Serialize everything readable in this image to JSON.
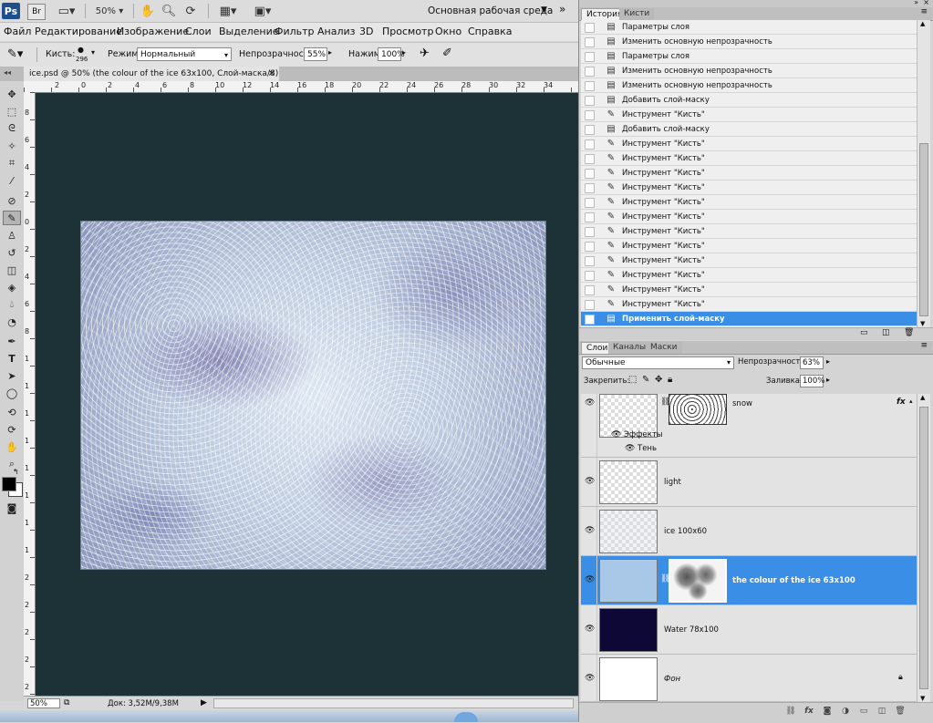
{
  "appbar": {
    "logo": "Ps",
    "bridge": "Br",
    "zoom": "50%",
    "workspace": "Основная рабочая среда"
  },
  "menu": [
    "Файл",
    "Редактирование",
    "Изображение",
    "Слои",
    "Выделение",
    "Фильтр",
    "Анализ",
    "3D",
    "Просмотр",
    "Окно",
    "Справка"
  ],
  "options": {
    "brush_label": "Кисть:",
    "brush_size": "296",
    "mode_label": "Режим:",
    "mode_value": "Нормальный",
    "opacity_label": "Непрозрачность:",
    "opacity_value": "55%",
    "flow_label": "Нажим:",
    "flow_value": "100%"
  },
  "document": {
    "tab_title": "ice.psd @ 50% (the colour of the ice 63x100, Слой-маска/8) *",
    "close": "×",
    "ruler_top": [
      "2",
      "0",
      "2",
      "4",
      "6",
      "8",
      "10",
      "12",
      "14",
      "16",
      "18",
      "20",
      "22",
      "24",
      "26",
      "28",
      "30",
      "32",
      "34"
    ],
    "ruler_left": [
      "8",
      "6",
      "4",
      "2",
      "0",
      "2",
      "4",
      "6",
      "8",
      "1",
      "1",
      "1",
      "1",
      "1",
      "1",
      "1",
      "1",
      "2",
      "2",
      "2",
      "2",
      "2"
    ]
  },
  "status": {
    "zoom": "50%",
    "doc_info": "Док: 3,52M/9,38M"
  },
  "history_panel": {
    "tabs": [
      "История",
      "Кисти"
    ],
    "items": [
      {
        "icon": "layer-icon",
        "label": "Параметры слоя"
      },
      {
        "icon": "layer-icon",
        "label": "Изменить основную непрозрачность"
      },
      {
        "icon": "layer-icon",
        "label": "Параметры слоя"
      },
      {
        "icon": "layer-icon",
        "label": "Изменить основную непрозрачность"
      },
      {
        "icon": "layer-icon",
        "label": "Изменить основную непрозрачность"
      },
      {
        "icon": "layer-icon",
        "label": "Добавить слой-маску"
      },
      {
        "icon": "brush-icon",
        "label": "Инструмент \"Кисть\""
      },
      {
        "icon": "layer-icon",
        "label": "Добавить слой-маску"
      },
      {
        "icon": "brush-icon",
        "label": "Инструмент \"Кисть\""
      },
      {
        "icon": "brush-icon",
        "label": "Инструмент \"Кисть\""
      },
      {
        "icon": "brush-icon",
        "label": "Инструмент \"Кисть\""
      },
      {
        "icon": "brush-icon",
        "label": "Инструмент \"Кисть\""
      },
      {
        "icon": "brush-icon",
        "label": "Инструмент \"Кисть\""
      },
      {
        "icon": "brush-icon",
        "label": "Инструмент \"Кисть\""
      },
      {
        "icon": "brush-icon",
        "label": "Инструмент \"Кисть\""
      },
      {
        "icon": "brush-icon",
        "label": "Инструмент \"Кисть\""
      },
      {
        "icon": "brush-icon",
        "label": "Инструмент \"Кисть\""
      },
      {
        "icon": "brush-icon",
        "label": "Инструмент \"Кисть\""
      },
      {
        "icon": "brush-icon",
        "label": "Инструмент \"Кисть\""
      },
      {
        "icon": "brush-icon",
        "label": "Инструмент \"Кисть\""
      },
      {
        "icon": "layer-icon",
        "label": "Применить слой-маску",
        "selected": true
      }
    ]
  },
  "layers_panel": {
    "tabs": [
      "Слои",
      "Каналы",
      "Маски"
    ],
    "blend_mode": "Обычные",
    "opacity_label": "Непрозрачность:",
    "opacity_value": "63%",
    "lock_label": "Закрепить:",
    "fill_label": "Заливка:",
    "fill_value": "100%",
    "effects_label": "Эффекты",
    "shadow_label": "Тень",
    "fx": "fx",
    "layers": [
      {
        "name": "snow",
        "thumb": "transparent",
        "mask": "snow-mask",
        "has_fx": true
      },
      {
        "name": "light",
        "thumb": "transparent"
      },
      {
        "name": "ice  100x60",
        "thumb": "transparent-light"
      },
      {
        "name": "the colour of the ice 63x100",
        "thumb_color": "#a9c8e8",
        "mask": "blob-mask",
        "selected": true
      },
      {
        "name": "Water 78x100",
        "thumb_color": "#0d0836"
      },
      {
        "name": "Фон",
        "thumb_color": "#ffffff",
        "locked": true
      }
    ]
  },
  "colors": {
    "canvas_bg": "#1c3236",
    "selection": "#3a8ee6"
  }
}
